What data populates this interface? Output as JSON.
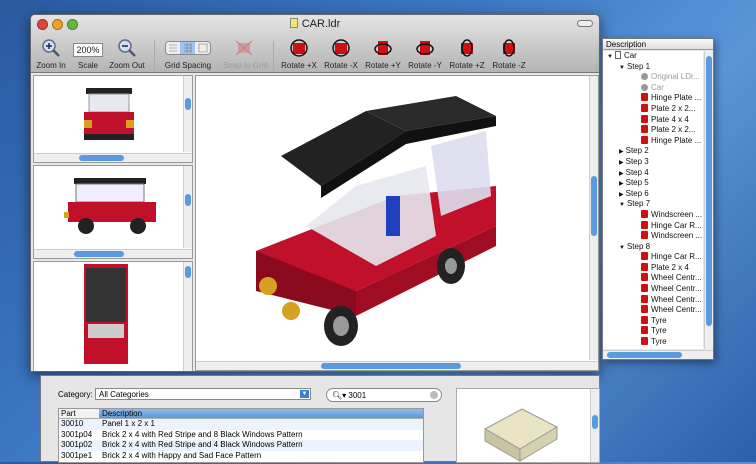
{
  "window": {
    "title": "CAR.ldr"
  },
  "toolbar": {
    "zoom_in": "Zoom In",
    "scale_label": "Scale",
    "scale_value": "200%",
    "zoom_out": "Zoom Out",
    "grid_spacing": "Grid Spacing",
    "snap_to_grid": "Snap to Grid",
    "rotate_px": "Rotate +X",
    "rotate_mx": "Rotate -X",
    "rotate_py": "Rotate +Y",
    "rotate_my": "Rotate -Y",
    "rotate_pz": "Rotate +Z",
    "rotate_mz": "Rotate -Z"
  },
  "colors": {
    "accent": "#3a7fd0",
    "brick": "#d01010"
  },
  "drawer": {
    "header": "Description",
    "rows": [
      {
        "label": "Car",
        "indent": 0,
        "icon": "doc",
        "disclosure": "open"
      },
      {
        "label": "Step 1",
        "indent": 1,
        "disclosure": "open"
      },
      {
        "label": "Original LDr...",
        "indent": 2,
        "icon": "question",
        "gray": true
      },
      {
        "label": "Car",
        "indent": 2,
        "icon": "question",
        "gray": true
      },
      {
        "label": "Hinge Plate ...",
        "indent": 2,
        "icon": "brick"
      },
      {
        "label": "Plate  2 x  2...",
        "indent": 2,
        "icon": "brick"
      },
      {
        "label": "Plate  4 x  4",
        "indent": 2,
        "icon": "brick"
      },
      {
        "label": "Plate  2 x  2...",
        "indent": 2,
        "icon": "brick"
      },
      {
        "label": "Hinge Plate ...",
        "indent": 2,
        "icon": "brick"
      },
      {
        "label": "Step 2",
        "indent": 1,
        "disclosure": "closed"
      },
      {
        "label": "Step 3",
        "indent": 1,
        "disclosure": "closed"
      },
      {
        "label": "Step 4",
        "indent": 1,
        "disclosure": "closed"
      },
      {
        "label": "Step 5",
        "indent": 1,
        "disclosure": "closed"
      },
      {
        "label": "Step 6",
        "indent": 1,
        "disclosure": "closed"
      },
      {
        "label": "Step 7",
        "indent": 1,
        "disclosure": "open"
      },
      {
        "label": "Windscreen ...",
        "indent": 2,
        "icon": "brick"
      },
      {
        "label": "Hinge Car R...",
        "indent": 2,
        "icon": "brick"
      },
      {
        "label": "Windscreen ...",
        "indent": 2,
        "icon": "brick"
      },
      {
        "label": "Step 8",
        "indent": 1,
        "disclosure": "open"
      },
      {
        "label": "Hinge Car R...",
        "indent": 2,
        "icon": "brick"
      },
      {
        "label": "Plate  2 x  4",
        "indent": 2,
        "icon": "brick"
      },
      {
        "label": "Wheel Centr...",
        "indent": 2,
        "icon": "brick"
      },
      {
        "label": "Wheel Centr...",
        "indent": 2,
        "icon": "brick"
      },
      {
        "label": "Wheel Centr...",
        "indent": 2,
        "icon": "brick"
      },
      {
        "label": "Wheel Centr...",
        "indent": 2,
        "icon": "brick"
      },
      {
        "label": "Tyre",
        "indent": 2,
        "icon": "brick"
      },
      {
        "label": "Tyre",
        "indent": 2,
        "icon": "brick"
      },
      {
        "label": "Tyre",
        "indent": 2,
        "icon": "brick"
      }
    ]
  },
  "parts": {
    "category_label": "Category:",
    "category_value": "All Categories",
    "search_value": "3001",
    "col_part": "Part",
    "col_desc": "Description",
    "rows": [
      {
        "part": "30010",
        "desc": "Panel  1 x  2 x  1"
      },
      {
        "part": "3001p04",
        "desc": "Brick  2 x  4 with Red Stripe and 8 Black Windows Pattern"
      },
      {
        "part": "3001p02",
        "desc": "Brick  2 x  4 with Red Stripe and 4 Black Windows Pattern"
      },
      {
        "part": "3001pe1",
        "desc": "Brick  2 x  4 with Happy and Sad Face Pattern"
      }
    ]
  }
}
